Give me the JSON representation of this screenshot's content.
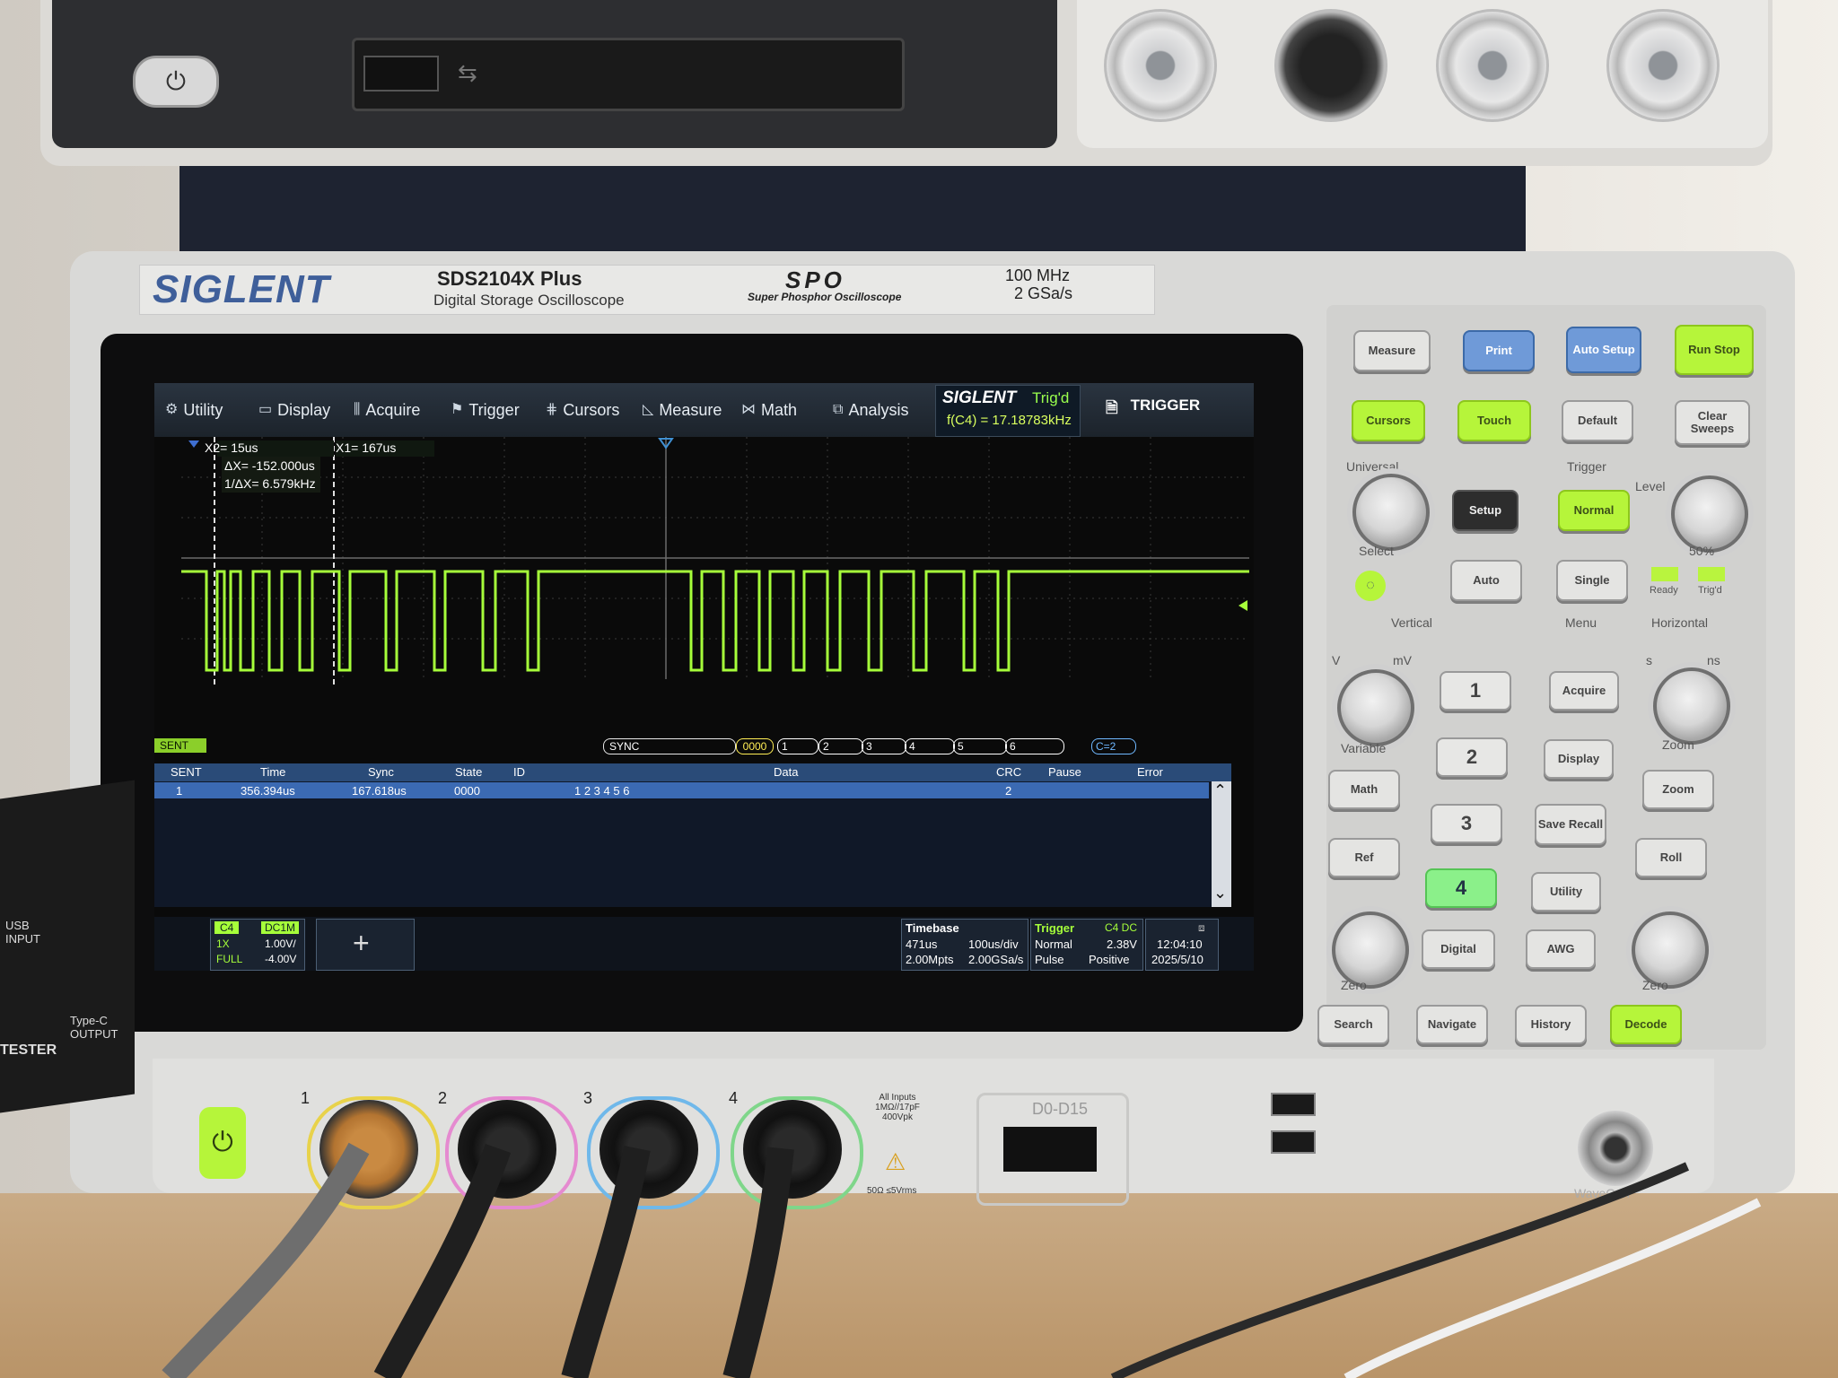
{
  "upper_instrument": {
    "power_icon": "power-icon",
    "usb_icon": "usb-icon"
  },
  "brand": {
    "logo": "SIGLENT",
    "model": "SDS2104X  Plus",
    "model_subtitle": "Digital Storage Oscilloscope",
    "tech_logo": "SPO",
    "tech_subtitle": "Super Phosphor Oscilloscope",
    "bandwidth": "100 MHz",
    "sample_rate": "2 GSa/s"
  },
  "menubar": {
    "items": [
      {
        "label": "Utility",
        "icon": "gear-icon"
      },
      {
        "label": "Display",
        "icon": "display-icon"
      },
      {
        "label": "Acquire",
        "icon": "acquire-icon"
      },
      {
        "label": "Trigger",
        "icon": "trigger-icon"
      },
      {
        "label": "Cursors",
        "icon": "cursors-icon"
      },
      {
        "label": "Measure",
        "icon": "measure-icon"
      },
      {
        "label": "Math",
        "icon": "math-icon"
      },
      {
        "label": "Analysis",
        "icon": "analysis-icon"
      }
    ],
    "brand_name": "SIGLENT",
    "trigger_state": "Trig'd",
    "frequency": "f(C4) = 17.18783kHz",
    "trigger_menu": "TRIGGER"
  },
  "cursors": {
    "x2": "X2= 15us",
    "x1": "X1= 167us",
    "delta_x": "ΔX= -152.000us",
    "inv_delta_x": "1/ΔX= 6.579kHz"
  },
  "decode": {
    "channel_label": "SENT",
    "sync_label": "SYNC",
    "status_label": "0000",
    "nibbles": [
      "1",
      "2",
      "3",
      "4",
      "5",
      "6"
    ],
    "crc_label": "C=2"
  },
  "decode_table": {
    "headers": [
      "SENT",
      "Time",
      "Sync",
      "State",
      "ID",
      "Data",
      "CRC",
      "Pause",
      "Error"
    ],
    "rows": [
      [
        "1",
        "356.394us",
        "167.618us",
        "0000",
        "",
        "1 2 3 4 5 6",
        "2",
        "",
        ""
      ]
    ]
  },
  "channel_info": {
    "channel": "C4",
    "coupling": "DC1M",
    "probe": "1X",
    "scale": "1.00V/",
    "bandwidth": "FULL",
    "offset": "-4.00V"
  },
  "timebase": {
    "title": "Timebase",
    "delay": "471us",
    "scale": "100us/div",
    "memory": "2.00Mpts",
    "sample_rate": "2.00GSa/s"
  },
  "trigger": {
    "title": "Trigger",
    "source": "C4 DC",
    "mode": "Normal",
    "level": "2.38V",
    "type": "Pulse",
    "slope": "Positive"
  },
  "clock": {
    "time": "12:04:10",
    "date": "2025/5/10"
  },
  "front_buttons": {
    "measure": "Measure",
    "print": "Print",
    "auto_setup": "Auto Setup",
    "run_stop": "Run Stop",
    "cursors": "Cursors",
    "touch": "Touch",
    "default": "Default",
    "clear_sweeps": "Clear Sweeps",
    "universal": "Universal",
    "select": "Select",
    "trigger_section": "Trigger",
    "setup": "Setup",
    "normal": "Normal",
    "level": "Level",
    "fifty_pct": "50%",
    "auto": "Auto",
    "single": "Single",
    "ready": "Ready",
    "trigd": "Trig'd",
    "vertical": "Vertical",
    "menu": "Menu",
    "horizontal": "Horizontal",
    "variable": "Variable",
    "zoom_label": "Zoom",
    "ch1": "1",
    "ch2": "2",
    "ch3": "3",
    "ch4": "4",
    "math": "Math",
    "ref": "Ref",
    "digital": "Digital",
    "acquire": "Acquire",
    "display": "Display",
    "save_recall": "Save Recall",
    "utility": "Utility",
    "awg": "AWG",
    "zoom": "Zoom",
    "roll": "Roll",
    "zero": "Zero",
    "search": "Search",
    "navigate": "Navigate",
    "history": "History",
    "decode": "Decode",
    "v": "V",
    "mv": "mV",
    "s": "s",
    "ns": "ns"
  },
  "front_panel": {
    "channels": [
      "1",
      "2",
      "3",
      "4"
    ],
    "input_spec": "All Inputs 1MΩ//17pF 400Vpk",
    "input_spec2": "50Ω ≤5Vrms",
    "digital_port": "D0-D15",
    "wavegen": "WaveGen"
  },
  "tester": {
    "usb_input": "USB INPUT",
    "typec_output": "Type-C OUTPUT",
    "label": "TESTER"
  },
  "colors": {
    "trace": "#a6ff3a",
    "menubar": "#1f2832",
    "accent_green": "#b6f53a",
    "table_header": "#2a4b78"
  }
}
